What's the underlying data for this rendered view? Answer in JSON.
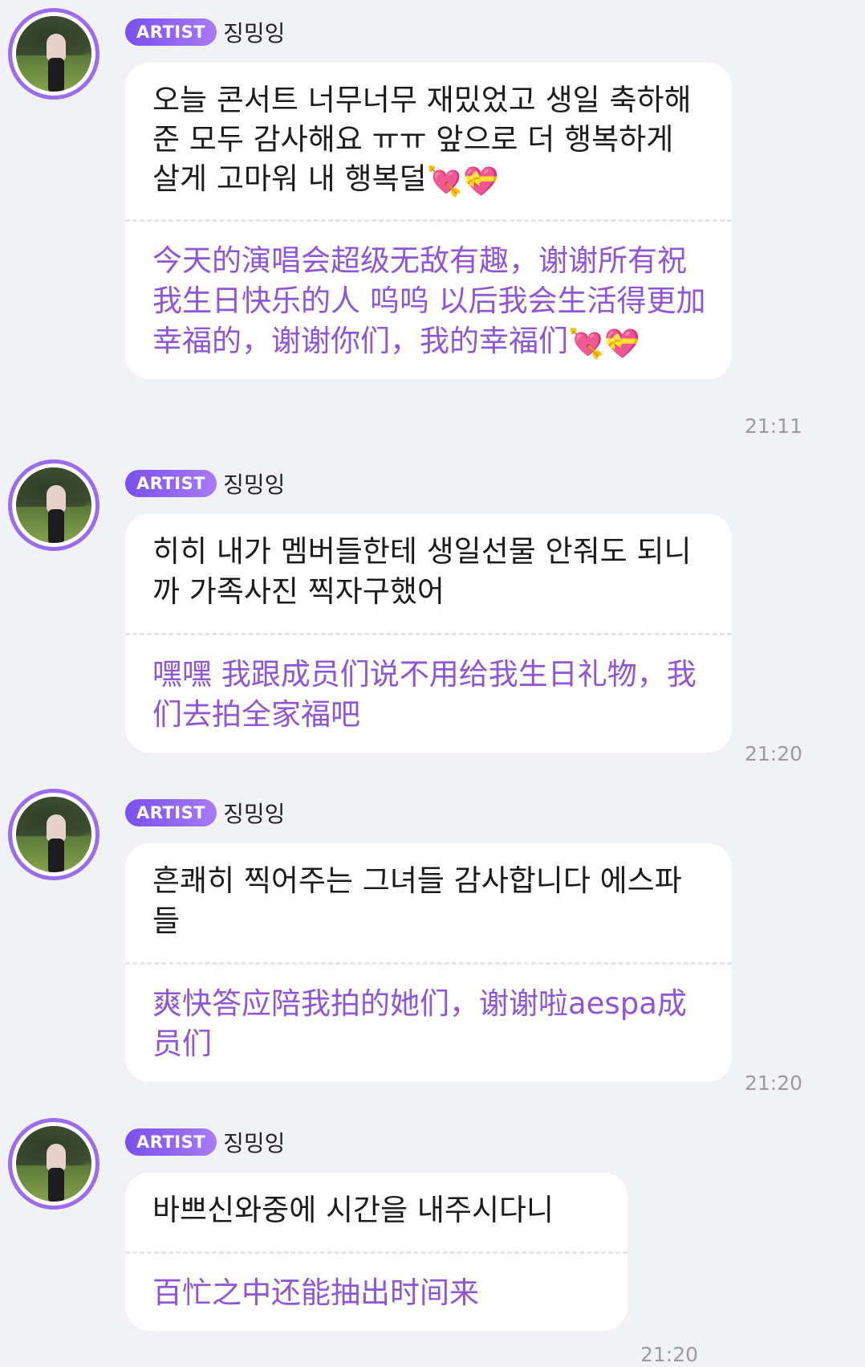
{
  "messages": [
    {
      "badge": "ARTIST",
      "author": "징밍잉",
      "korean": "오늘 콘서트 너무너무 재밌었고 생일 축하해준 모두 감사해요 ㅠㅠ 앞으로 더 행복하게 살게 고마워 내 행복덜",
      "korean_emoji": "💘💝",
      "chinese": "今天的演唱会超级无敌有趣，谢谢所有祝我生日快乐的人 呜呜 以后我会生活得更加幸福的，谢谢你们，我的幸福们",
      "chinese_emoji": "💘💝",
      "time": "21:11"
    },
    {
      "badge": "ARTIST",
      "author": "징밍잉",
      "korean": "히히 내가 멤버들한테 생일선물 안줘도 되니까 가족사진 찍자구했어",
      "chinese": "嘿嘿 我跟成员们说不用给我生日礼物，我们去拍全家福吧",
      "time": "21:20"
    },
    {
      "badge": "ARTIST",
      "author": "징밍잉",
      "korean": "흔쾌히 찍어주는 그녀들 감사합니다 에스파들",
      "chinese": "爽快答应陪我拍的她们，谢谢啦aespa成员们",
      "time": "21:20"
    },
    {
      "badge": "ARTIST",
      "author": "징밍잉",
      "korean": "바쁘신와중에 시간을 내주시다니",
      "chinese": "百忙之中还能抽出时间来",
      "time": "21:20"
    }
  ],
  "colors": {
    "background": "#f1f2f6",
    "badge_start": "#7a4ff0",
    "badge_end": "#a77bf6",
    "translation_text": "#8f55d9",
    "avatar_ring": "#9b6cf0"
  }
}
